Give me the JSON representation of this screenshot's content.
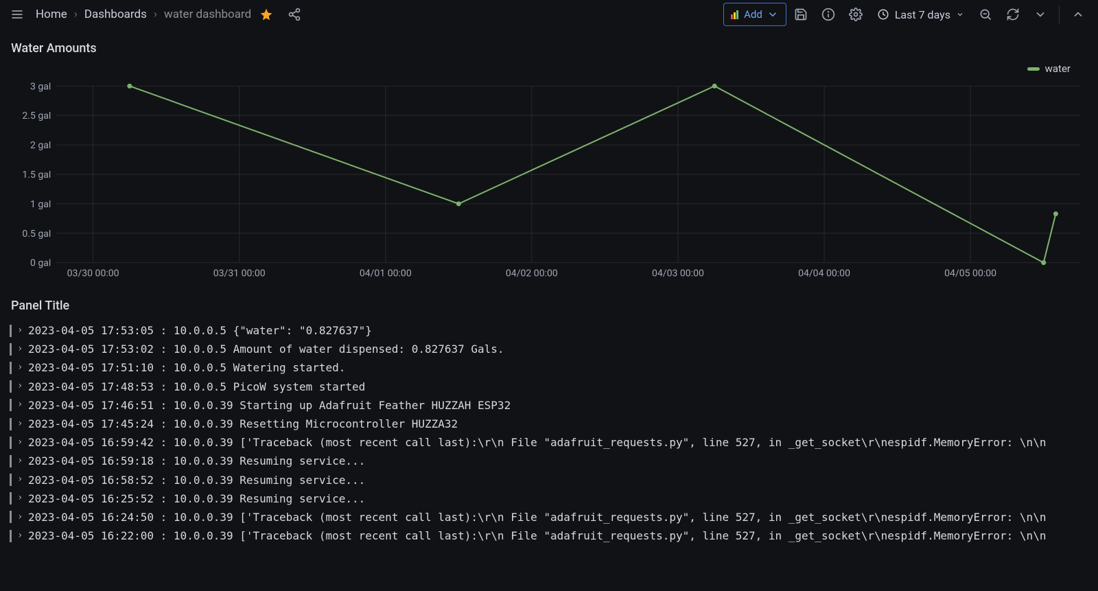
{
  "toolbar": {
    "add_label": "Add",
    "time_range": "Last 7 days"
  },
  "breadcrumb": {
    "home": "Home",
    "section": "Dashboards",
    "page": "water dashboard"
  },
  "panels": {
    "chart_title": "Water Amounts",
    "legend": "water",
    "logs_title": "Panel Title"
  },
  "chart_data": {
    "type": "line",
    "title": "Water Amounts",
    "xlabel": "",
    "ylabel": "",
    "x_ticks": [
      "03/30 00:00",
      "03/31 00:00",
      "04/01 00:00",
      "04/02 00:00",
      "04/03 00:00",
      "04/04 00:00",
      "04/05 00:00"
    ],
    "y_ticks": [
      "0 gal",
      "0.5 gal",
      "1 gal",
      "1.5 gal",
      "2 gal",
      "2.5 gal",
      "3 gal"
    ],
    "ylim": [
      0,
      3
    ],
    "xlim": [
      "2023-03-29T18:00:00",
      "2023-04-05T18:00:00"
    ],
    "series": [
      {
        "name": "water",
        "color": "#7eb26d",
        "points": [
          {
            "x": "2023-03-30T06:00:00",
            "y": 3.0
          },
          {
            "x": "2023-04-01T12:00:00",
            "y": 1.0
          },
          {
            "x": "2023-04-03T06:00:00",
            "y": 3.0
          },
          {
            "x": "2023-04-05T12:00:00",
            "y": 0.0
          },
          {
            "x": "2023-04-05T14:00:00",
            "y": 0.83
          }
        ]
      }
    ]
  },
  "logs": [
    "2023-04-05 17:53:05 : 10.0.0.5 {\"water\": \"0.827637\"}",
    "2023-04-05 17:53:02 : 10.0.0.5 Amount of water dispensed: 0.827637 Gals.",
    "2023-04-05 17:51:10 : 10.0.0.5 Watering started.",
    "2023-04-05 17:48:53 : 10.0.0.5 PicoW system started",
    "2023-04-05 17:46:51 : 10.0.0.39 Starting up Adafruit Feather HUZZAH ESP32",
    "2023-04-05 17:45:24 : 10.0.0.39 Resetting Microcontroller HUZZA32",
    "2023-04-05 16:59:42 : 10.0.0.39 ['Traceback (most recent call last):\\r\\n File \"adafruit_requests.py\", line 527, in _get_socket\\r\\nespidf.MemoryError: \\n\\n",
    "2023-04-05 16:59:18 : 10.0.0.39 Resuming service...",
    "2023-04-05 16:58:52 : 10.0.0.39 Resuming service...",
    "2023-04-05 16:25:52 : 10.0.0.39 Resuming service...",
    "2023-04-05 16:24:50 : 10.0.0.39 ['Traceback (most recent call last):\\r\\n File \"adafruit_requests.py\", line 527, in _get_socket\\r\\nespidf.MemoryError: \\n\\n",
    "2023-04-05 16:22:00 : 10.0.0.39 ['Traceback (most recent call last):\\r\\n File \"adafruit_requests.py\", line 527, in _get_socket\\r\\nespidf.MemoryError: \\n\\n"
  ]
}
